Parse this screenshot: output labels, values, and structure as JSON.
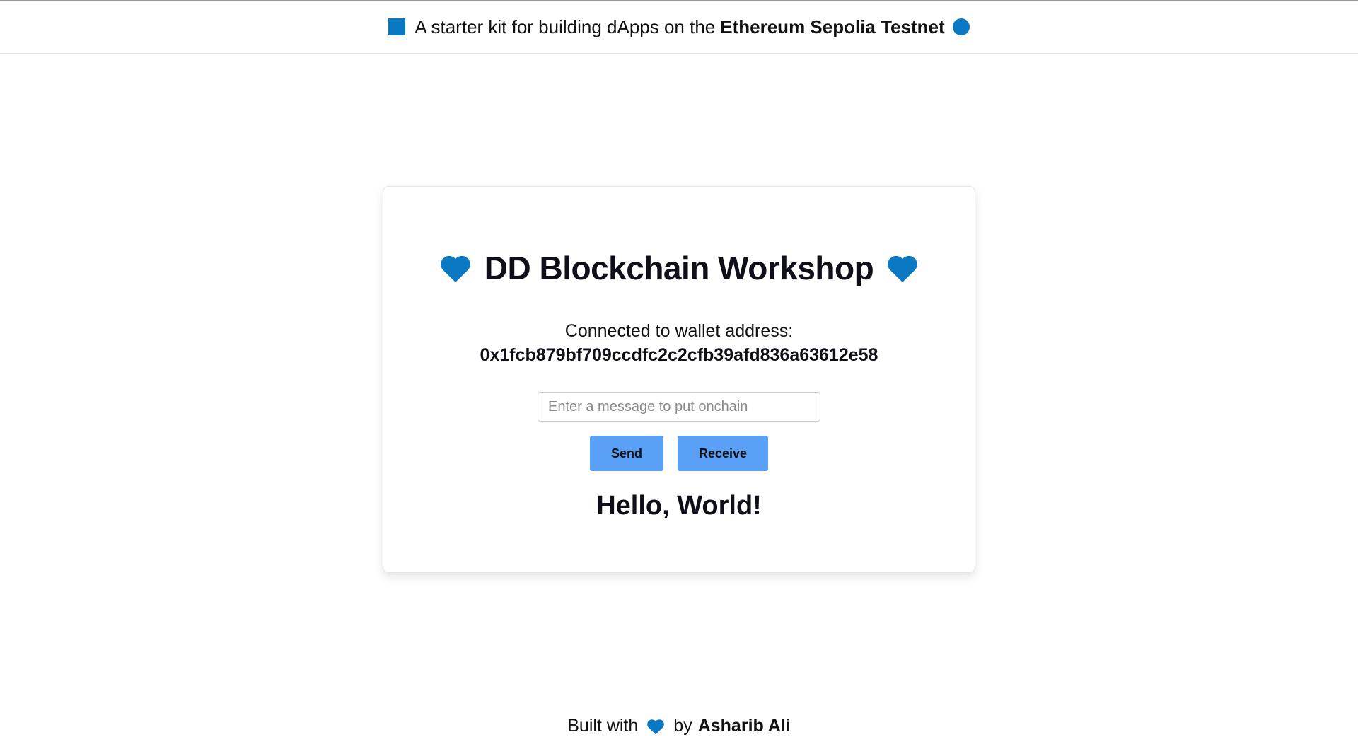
{
  "banner": {
    "text": "A starter kit for building dApps on the",
    "network": "Ethereum Sepolia Testnet",
    "square_icon": "blue-square-icon",
    "dot_icon": "blue-circle-icon"
  },
  "card": {
    "title": "DD Blockchain Workshop",
    "heart_icon": "blue-heart-icon",
    "connected_label": "Connected to wallet address:",
    "wallet_address": "0x1fcb879bf709ccdfc2c2cfb39afd836a63612e58",
    "message_input": {
      "placeholder": "Enter a message to put onchain",
      "value": ""
    },
    "send_label": "Send",
    "receive_label": "Receive",
    "message_output": "Hello, World!"
  },
  "footer": {
    "built_with": "Built with",
    "by": "by",
    "author": "Asharib Ali"
  },
  "colors": {
    "accent": "#0a78c2",
    "button": "#5aa0f7",
    "text": "#0f0f19"
  }
}
